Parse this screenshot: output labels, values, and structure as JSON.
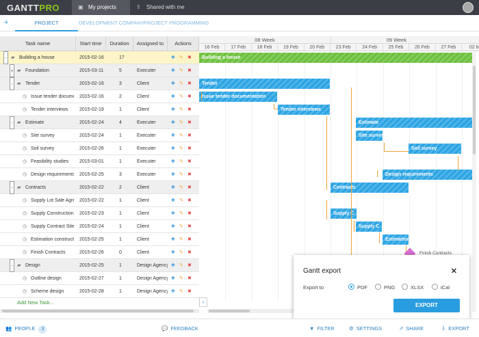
{
  "app": {
    "logo_part1": "GANTT",
    "logo_part2": "PRO"
  },
  "top_tabs": [
    {
      "label": "My projects",
      "icon": "folder-icon"
    },
    {
      "label": "Shared with me",
      "icon": "share-icon"
    }
  ],
  "project_tabs": [
    "PROJECT",
    "DEVELOPMENT COMPANY",
    "PROJECT PROGRAMMING"
  ],
  "grid": {
    "headers": [
      "Task name",
      "Start time",
      "Duration",
      "Assigned to",
      "Actions"
    ],
    "rows": [
      {
        "name": "Building a house",
        "start": "2015-02-16",
        "duration": "17",
        "assigned": "",
        "level": 0,
        "type": "project",
        "toggle": "-"
      },
      {
        "name": "Foundation",
        "start": "2015-03-11",
        "duration": "5",
        "assigned": "Executer",
        "level": 1,
        "type": "group",
        "toggle": "+"
      },
      {
        "name": "Tender",
        "start": "2015-02-16",
        "duration": "3",
        "assigned": "Client",
        "level": 1,
        "type": "group",
        "toggle": "-"
      },
      {
        "name": "Issue tender documentation",
        "start": "2015-02-16",
        "duration": "2",
        "assigned": "Client",
        "level": 2,
        "type": "task",
        "toggle": ""
      },
      {
        "name": "Tender interviews",
        "start": "2015-02-19",
        "duration": "1",
        "assigned": "Client",
        "level": 2,
        "type": "task",
        "toggle": ""
      },
      {
        "name": "Estimate",
        "start": "2015-02-24",
        "duration": "4",
        "assigned": "Executer",
        "level": 1,
        "type": "group",
        "toggle": "-"
      },
      {
        "name": "Site survey",
        "start": "2015-02-24",
        "duration": "1",
        "assigned": "Executer",
        "level": 2,
        "type": "task",
        "toggle": ""
      },
      {
        "name": "Soil survey",
        "start": "2015-02-26",
        "duration": "1",
        "assigned": "Executer",
        "level": 2,
        "type": "task",
        "toggle": ""
      },
      {
        "name": "Feasibility studies",
        "start": "2015-03-01",
        "duration": "1",
        "assigned": "Executer",
        "level": 2,
        "type": "task",
        "toggle": ""
      },
      {
        "name": "Design requirements",
        "start": "2015-02-25",
        "duration": "3",
        "assigned": "Executer",
        "level": 2,
        "type": "task",
        "toggle": ""
      },
      {
        "name": "Contracts",
        "start": "2015-02-22",
        "duration": "2",
        "assigned": "Client",
        "level": 1,
        "type": "group",
        "toggle": "-"
      },
      {
        "name": "Supply Lot Sale Agre",
        "start": "2015-02-22",
        "duration": "1",
        "assigned": "Client",
        "level": 2,
        "type": "task",
        "toggle": ""
      },
      {
        "name": "Supply Construction...",
        "start": "2015-02-23",
        "duration": "1",
        "assigned": "Client",
        "level": 2,
        "type": "task",
        "toggle": ""
      },
      {
        "name": "Supply Contract Site",
        "start": "2015-02-24",
        "duration": "1",
        "assigned": "Client",
        "level": 2,
        "type": "task",
        "toggle": ""
      },
      {
        "name": "Estimation constructi",
        "start": "2015-02-25",
        "duration": "1",
        "assigned": "Client",
        "level": 2,
        "type": "task",
        "toggle": ""
      },
      {
        "name": "Finish Contracts",
        "start": "2015-02-26",
        "duration": "0",
        "assigned": "Client",
        "level": 2,
        "type": "task",
        "toggle": ""
      },
      {
        "name": "Design",
        "start": "2015-02-25",
        "duration": "1",
        "assigned": "Design Agency",
        "level": 1,
        "type": "group",
        "toggle": "-"
      },
      {
        "name": "Outline design",
        "start": "2015-02-27",
        "duration": "1",
        "assigned": "Design Agency",
        "level": 2,
        "type": "task",
        "toggle": ""
      },
      {
        "name": "Scheme design",
        "start": "2015-02-28",
        "duration": "1",
        "assigned": "Design Agency",
        "level": 2,
        "type": "task",
        "toggle": ""
      }
    ],
    "add_task_label": "Add New Task..."
  },
  "timeline": {
    "weeks": [
      "08 Week",
      "09 Week"
    ],
    "days": [
      "16 Feb",
      "17 Feb",
      "18 Feb",
      "19 Feb",
      "20 Feb",
      "23 Feb",
      "24 Feb",
      "25 Feb",
      "26 Feb",
      "27 Feb",
      "02 M"
    ]
  },
  "bars": [
    {
      "label": "Building a house",
      "color": "#6abf3a",
      "row": 0
    },
    {
      "label": "Tender",
      "color": "#29a3e3",
      "row": 2
    },
    {
      "label": "Issue tender documentation",
      "color": "#29a3e3",
      "row": 3
    },
    {
      "label": "Tender interviews",
      "color": "#29a3e3",
      "row": 4
    },
    {
      "label": "Estimate",
      "color": "#29a3e3",
      "row": 5
    },
    {
      "label": "Site survey",
      "color": "#29a3e3",
      "row": 6
    },
    {
      "label": "Soil survey",
      "color": "#29a3e3",
      "row": 7
    },
    {
      "label": "Design requirements",
      "color": "#29a3e3",
      "row": 9
    },
    {
      "label": "Contracts",
      "color": "#29a3e3",
      "row": 10
    },
    {
      "label": "Supply C",
      "color": "#29a3e3",
      "row": 12
    },
    {
      "label": "Supply C",
      "color": "#29a3e3",
      "row": 13
    },
    {
      "label": "Estimation",
      "color": "#29a3e3",
      "row": 14
    }
  ],
  "milestone_label": "Finish Contracts",
  "export_dialog": {
    "title": "Gantt export",
    "export_to": "Export to",
    "options": [
      "PDF",
      "PNG",
      "XLSX",
      "iCal"
    ],
    "selected": "PDF",
    "button": "EXPORT"
  },
  "bottom": {
    "people": "PEOPLE",
    "people_count": "3",
    "feedback": "FEEDBACK",
    "filter": "FILTER",
    "settings": "SETTINGS",
    "share": "SHARE",
    "export": "EXPORT"
  }
}
